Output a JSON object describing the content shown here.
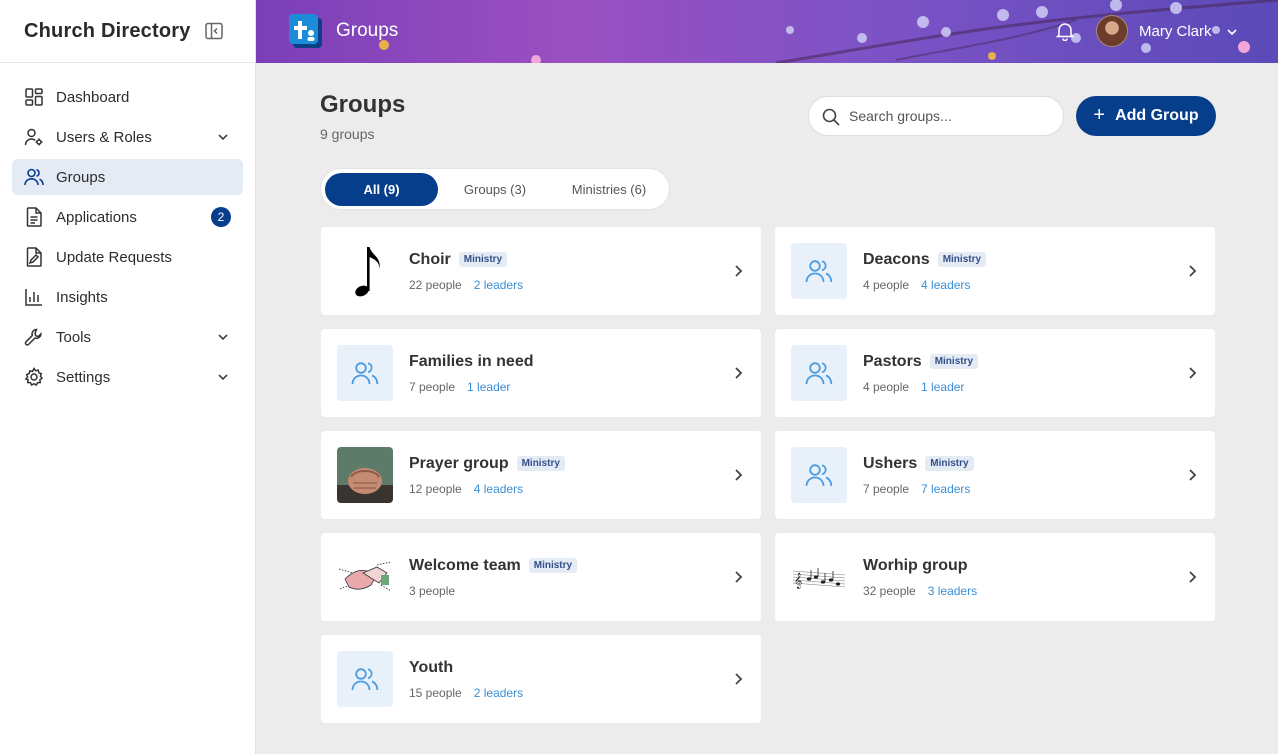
{
  "sidebar": {
    "app_name": "Church Directory",
    "items": [
      {
        "label": "Dashboard",
        "icon": "dashboard-icon"
      },
      {
        "label": "Users & Roles",
        "icon": "user-gear-icon",
        "expandable": true
      },
      {
        "label": "Groups",
        "icon": "users-icon",
        "active": true
      },
      {
        "label": "Applications",
        "icon": "document-icon",
        "badge": "2"
      },
      {
        "label": "Update Requests",
        "icon": "edit-document-icon"
      },
      {
        "label": "Insights",
        "icon": "bar-chart-icon"
      },
      {
        "label": "Tools",
        "icon": "wrench-icon",
        "expandable": true
      },
      {
        "label": "Settings",
        "icon": "gear-icon",
        "expandable": true
      }
    ]
  },
  "header": {
    "title": "Groups",
    "user_name": "Mary Clark"
  },
  "main": {
    "title": "Groups",
    "subtitle": "9 groups",
    "search_placeholder": "Search groups...",
    "add_label": "Add Group",
    "tabs": [
      {
        "label": "All (9)",
        "active": true
      },
      {
        "label": "Groups (3)"
      },
      {
        "label": "Ministries (6)"
      }
    ],
    "groups": [
      {
        "name": "Choir",
        "tag": "Ministry",
        "people": "22 people",
        "leaders": "2 leaders",
        "thumb": "music-note-image"
      },
      {
        "name": "Deacons",
        "tag": "Ministry",
        "people": "4 people",
        "leaders": "4 leaders",
        "thumb": "users-icon"
      },
      {
        "name": "Families in need",
        "tag": "",
        "people": "7 people",
        "leaders": "1 leader",
        "thumb": "users-icon"
      },
      {
        "name": "Pastors",
        "tag": "Ministry",
        "people": "4 people",
        "leaders": "1 leader",
        "thumb": "users-icon"
      },
      {
        "name": "Prayer group",
        "tag": "Ministry",
        "people": "12 people",
        "leaders": "4 leaders",
        "thumb": "praying-hands-image"
      },
      {
        "name": "Ushers",
        "tag": "Ministry",
        "people": "7 people",
        "leaders": "7 leaders",
        "thumb": "users-icon"
      },
      {
        "name": "Welcome team",
        "tag": "Ministry",
        "people": "3 people",
        "leaders": "",
        "thumb": "handshake-image"
      },
      {
        "name": "Worhip group",
        "tag": "",
        "people": "32 people",
        "leaders": "3 leaders",
        "thumb": "sheet-music-image"
      },
      {
        "name": "Youth",
        "tag": "",
        "people": "15 people",
        "leaders": "2 leaders",
        "thumb": "users-icon"
      }
    ]
  },
  "colors": {
    "accent": "#063e8c",
    "link": "#3a8ed6",
    "active_nav": "#e4ebf4"
  }
}
